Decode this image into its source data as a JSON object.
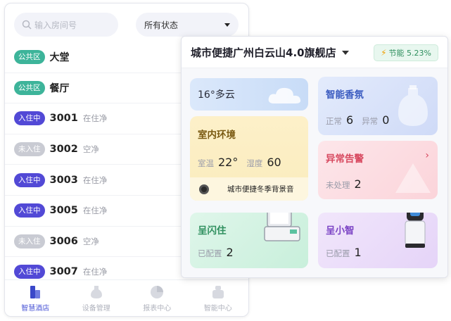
{
  "search": {
    "placeholder": "输入房间号"
  },
  "filter": {
    "selected": "所有状态"
  },
  "rooms": [
    {
      "tag": "公共区",
      "tag_type": "public",
      "number": "",
      "name": "大堂",
      "status": ""
    },
    {
      "tag": "公共区",
      "tag_type": "public",
      "number": "",
      "name": "餐厅",
      "status": ""
    },
    {
      "tag": "入住中",
      "tag_type": "occupied",
      "number": "3001",
      "name": "",
      "status": "在住净"
    },
    {
      "tag": "未入住",
      "tag_type": "vacant",
      "number": "3002",
      "name": "",
      "status": "空净"
    },
    {
      "tag": "入住中",
      "tag_type": "occupied",
      "number": "3003",
      "name": "",
      "status": "在住净"
    },
    {
      "tag": "入住中",
      "tag_type": "occupied",
      "number": "3005",
      "name": "",
      "status": "在住净"
    },
    {
      "tag": "未入住",
      "tag_type": "vacant",
      "number": "3006",
      "name": "",
      "status": "空净"
    },
    {
      "tag": "入住中",
      "tag_type": "occupied",
      "number": "3007",
      "name": "",
      "status": "在住净"
    }
  ],
  "nav": [
    {
      "label": "智慧酒店",
      "icon": "hotel-icon",
      "active": true
    },
    {
      "label": "设备管理",
      "icon": "device-icon",
      "active": false
    },
    {
      "label": "报表中心",
      "icon": "report-icon",
      "active": false
    },
    {
      "label": "智能中心",
      "icon": "smart-icon",
      "active": false
    }
  ],
  "dashboard": {
    "hotel_name": "城市便捷广州白云山4.0旗舰店",
    "energy_label": "节能 5.23%",
    "weather": {
      "text": "16°多云"
    },
    "scent": {
      "title": "智能香氛",
      "normal_label": "正常",
      "normal_count": "6",
      "abnormal_label": "异常",
      "abnormal_count": "0"
    },
    "environment": {
      "title": "室内环境",
      "temp_label": "室温",
      "temp_value": "22°",
      "humidity_label": "湿度",
      "humidity_value": "60",
      "music": "城市便捷冬季背景音"
    },
    "alert": {
      "title": "异常告警",
      "unhandled_label": "未处理",
      "unhandled_count": "2"
    },
    "checkin": {
      "title": "呈闪住",
      "configured_label": "已配置",
      "configured_count": "2"
    },
    "robot": {
      "title": "呈小智",
      "configured_label": "已配置",
      "configured_count": "1"
    }
  },
  "colors": {
    "accent": "#4a55d6",
    "public_tag": "#3db49a",
    "occupied_tag": "#5249d6",
    "vacant_tag": "#c9cbd3"
  }
}
